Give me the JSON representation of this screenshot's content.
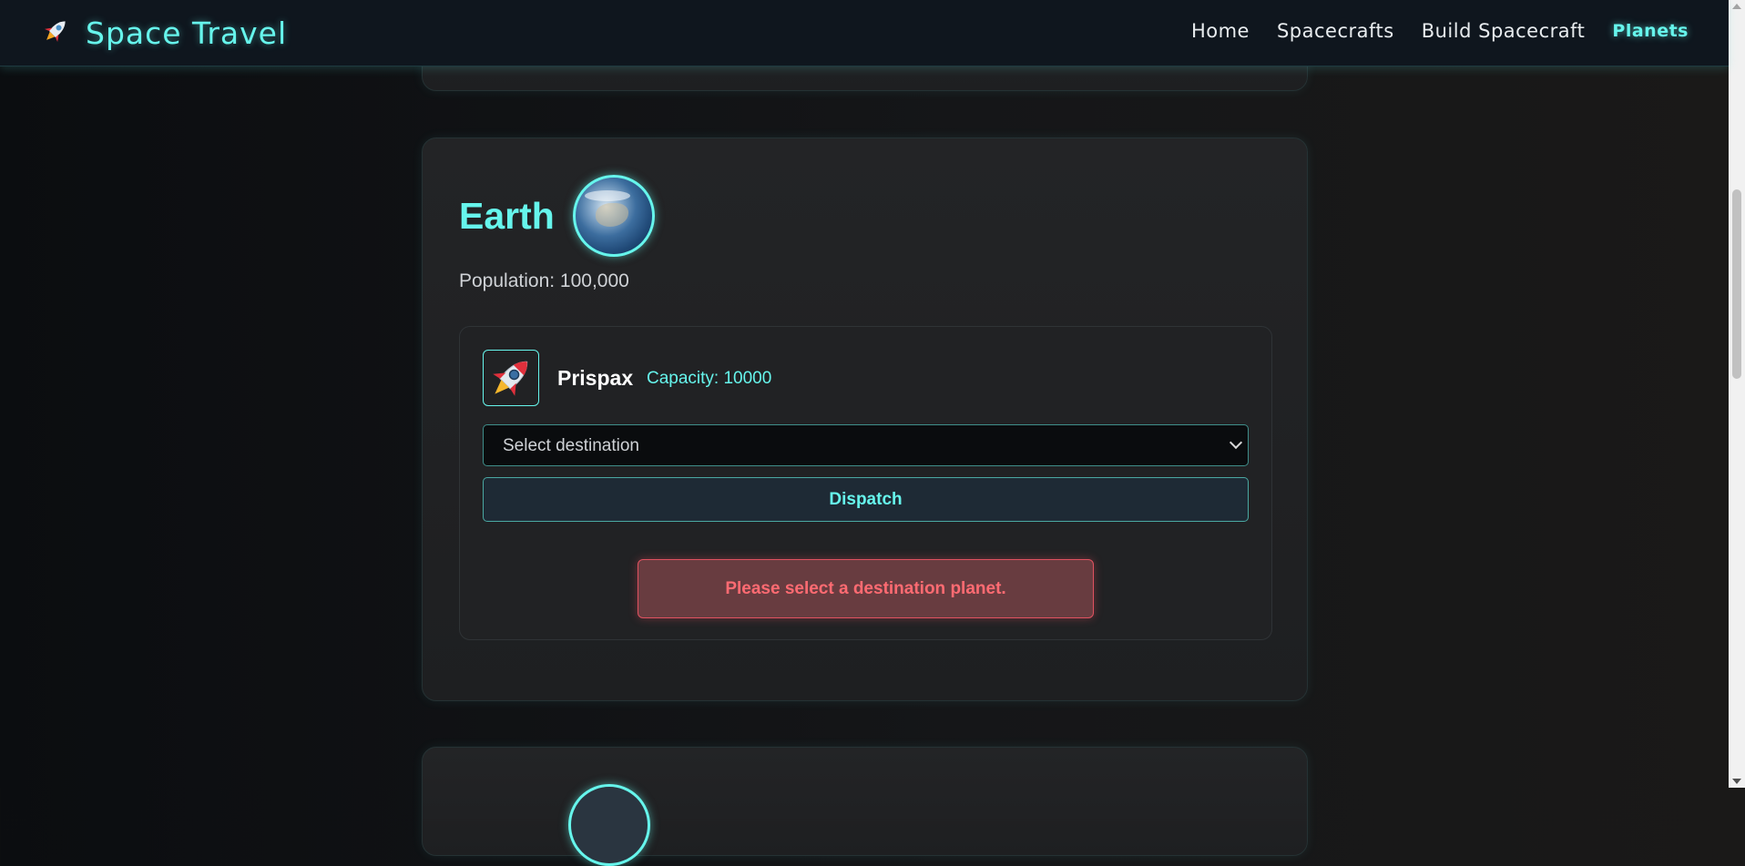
{
  "header": {
    "brand_title": "Space Travel",
    "nav": [
      "Home",
      "Spacecrafts",
      "Build Spacecraft",
      "Planets"
    ],
    "active_nav": "Planets"
  },
  "planet": {
    "name": "Earth",
    "population": "Population: 100,000"
  },
  "spacecraft": {
    "name": "Prispax",
    "capacity": "Capacity: 10000",
    "destination_placeholder": "Select destination",
    "dispatch_label": "Dispatch"
  },
  "error_message": "Please select a destination planet.",
  "icons": {
    "brand": "rocket-icon",
    "spacecraft": "rocket-icon",
    "select": "chevron-down-icon"
  },
  "colors": {
    "accent": "#66f5ec",
    "error": "#ff6b72",
    "error_bg": "#683c40"
  }
}
